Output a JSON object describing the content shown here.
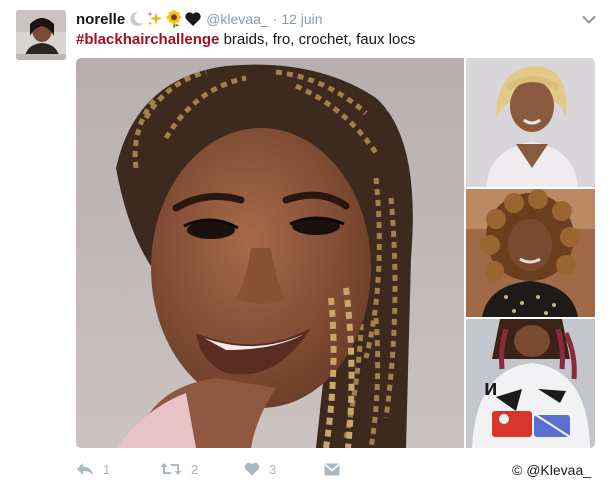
{
  "tweet": {
    "author": {
      "display_name": "norelle",
      "emojis": [
        "crescent-moon-icon",
        "sparkles-icon",
        "sunflower-icon",
        "black-heart-icon"
      ],
      "handle": "@klevaa_",
      "separator": "·",
      "date": "12 juin"
    },
    "text": {
      "hashtag": "#blackhairchallenge",
      "body": " braids, fro, crochet, faux locs"
    },
    "media": {
      "count": 4,
      "photos": [
        "main-braids-photo",
        "platinum-hair-photo",
        "curly-fro-photo",
        "faux-locs-photo"
      ]
    },
    "actions": {
      "reply_count": "1",
      "retweet_count": "2",
      "like_count": "3"
    },
    "colors": {
      "hashtag": "#a0102a",
      "muted": "#8899a6",
      "icon": "#aab8c2"
    }
  },
  "credit": "© @Klevaa_"
}
